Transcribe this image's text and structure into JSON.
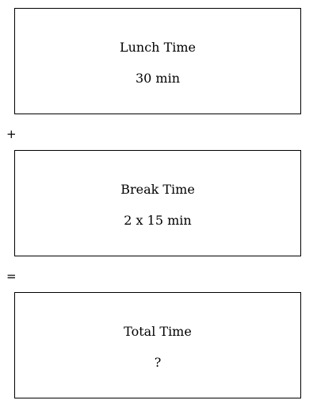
{
  "boxes": [
    {
      "label": "Lunch Time",
      "value": "30 min"
    },
    {
      "label": "Break Time",
      "value": "2 x 15 min"
    },
    {
      "label": "Total Time",
      "value": "?"
    }
  ],
  "operators": {
    "plus": "+",
    "equals": "="
  }
}
